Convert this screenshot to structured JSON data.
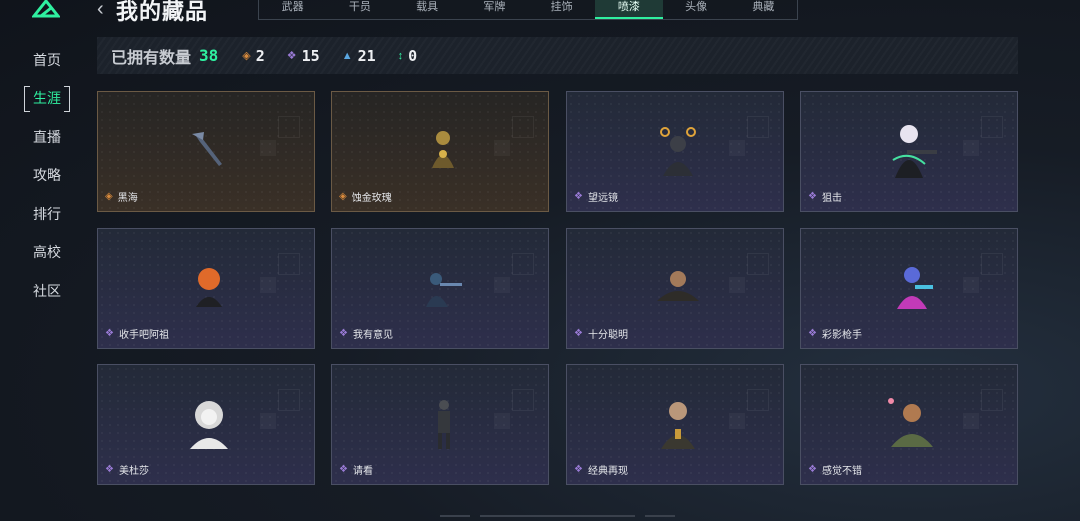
{
  "sidebar": {
    "items": [
      {
        "label": "首页"
      },
      {
        "label": "生涯"
      },
      {
        "label": "直播"
      },
      {
        "label": "攻略"
      },
      {
        "label": "排行"
      },
      {
        "label": "高校"
      },
      {
        "label": "社区"
      }
    ],
    "active_index": 1
  },
  "header": {
    "title": "我的藏品",
    "tabs": [
      "武器",
      "干员",
      "载具",
      "军牌",
      "挂饰",
      "喷漆",
      "头像",
      "典藏"
    ],
    "active_tab": 5
  },
  "stats": {
    "label": "已拥有数量",
    "total": "38",
    "items": [
      {
        "icon": "orange-rarity-icon",
        "value": "2"
      },
      {
        "icon": "purple-rarity-icon",
        "value": "15"
      },
      {
        "icon": "blue-rarity-icon",
        "value": "21"
      },
      {
        "icon": "green-rarity-icon",
        "value": "0"
      }
    ]
  },
  "cards": [
    {
      "name": "黑海",
      "rarity": "orange"
    },
    {
      "name": "蚀金玫瑰",
      "rarity": "orange"
    },
    {
      "name": "望远镜",
      "rarity": "purple"
    },
    {
      "name": "狙击",
      "rarity": "purple"
    },
    {
      "name": "收手吧阿祖",
      "rarity": "purple"
    },
    {
      "name": "我有意见",
      "rarity": "purple"
    },
    {
      "name": "十分聪明",
      "rarity": "purple"
    },
    {
      "name": "彩影枪手",
      "rarity": "purple"
    },
    {
      "name": "美杜莎",
      "rarity": "purple"
    },
    {
      "name": "请看",
      "rarity": "purple"
    },
    {
      "name": "经典再现",
      "rarity": "purple"
    },
    {
      "name": "感觉不错",
      "rarity": "purple"
    }
  ],
  "colors": {
    "accent": "#2ff0a0",
    "orange": "#d88a3c",
    "purple": "#9a7bd6",
    "blue": "#5aa6e0"
  }
}
